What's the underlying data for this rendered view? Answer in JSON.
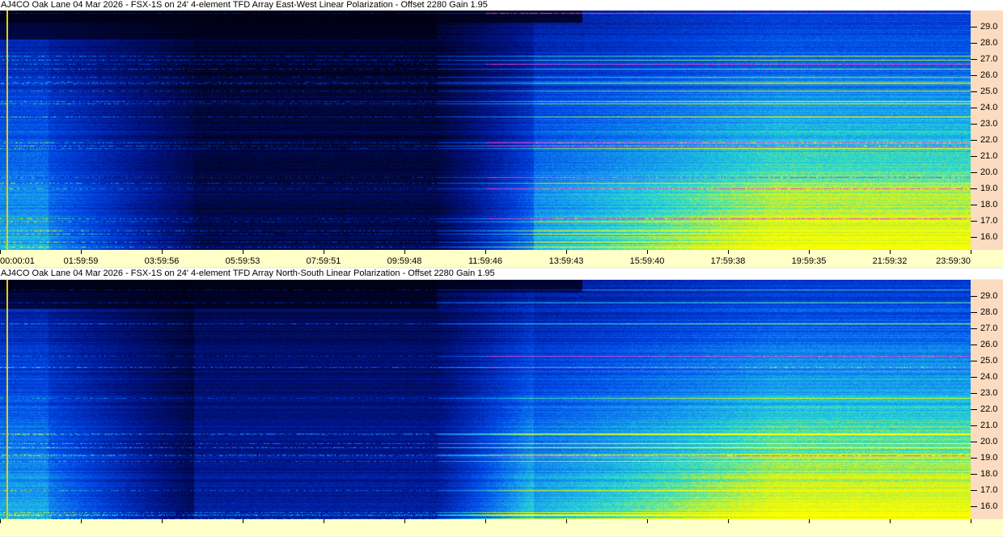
{
  "panels": [
    {
      "title": "AJ4CO Oak Lane 04 Mar 2026 - FSX-1S on 24' 4-element TFD Array East-West Linear Polarization  -  Offset 2280  Gain 1.95",
      "seed": 7,
      "night_level": 0.08
    },
    {
      "title": "AJ4CO Oak Lane 04 Mar 2026 - FSX-1S on 24' 4-element TFD Array North-South Linear Polarization  -  Offset 2280  Gain 1.95",
      "seed": 13,
      "night_level": 0.2
    }
  ],
  "freq_axis": {
    "unit": "MHz",
    "min": 15.2,
    "max": 30.0,
    "ticks": [
      "29.0",
      "28.0",
      "27.0",
      "26.0",
      "25.0",
      "24.0",
      "23.0",
      "22.0",
      "21.0",
      "20.0",
      "19.0",
      "18.0",
      "17.0",
      "16.0"
    ]
  },
  "time_axis": {
    "ticks": [
      "00:00:01",
      "01:59:59",
      "03:59:56",
      "05:59:53",
      "07:59:51",
      "09:59:48",
      "11:59:46",
      "13:59:43",
      "15:59:40",
      "17:59:38",
      "19:59:35",
      "21:59:32",
      "23:59:30"
    ]
  },
  "colors": {
    "background": "#000014",
    "freq_axis_bg": "#fbdcc0",
    "time_axis_bg": "#ffffc8",
    "marker": "#e8d000"
  }
}
